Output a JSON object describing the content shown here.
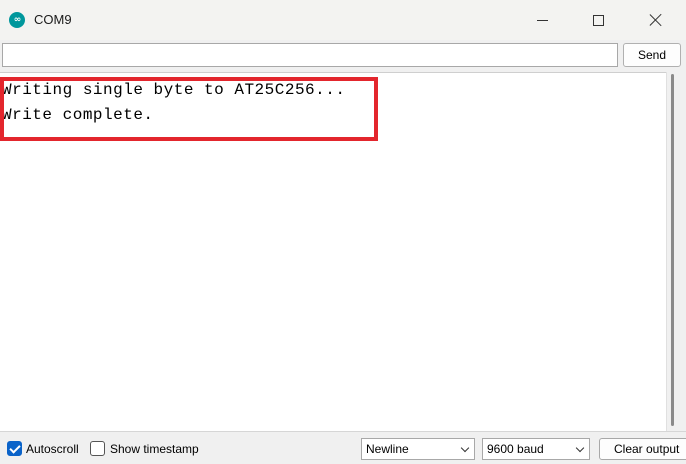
{
  "window": {
    "title": "COM9",
    "app_icon": "arduino-icon"
  },
  "send_bar": {
    "input_value": "",
    "send_label": "Send"
  },
  "output": {
    "lines": [
      "Writing single byte to AT25C256...",
      "Write complete."
    ],
    "highlight_color": "#e3262d"
  },
  "bottom_bar": {
    "autoscroll_label": "Autoscroll",
    "autoscroll_checked": true,
    "timestamp_label": "Show timestamp",
    "timestamp_checked": false,
    "line_ending": "Newline",
    "baud_rate": "9600 baud",
    "clear_label": "Clear output"
  },
  "colors": {
    "checkbox_accent": "#0a63c9",
    "icon_teal": "#00979c"
  }
}
